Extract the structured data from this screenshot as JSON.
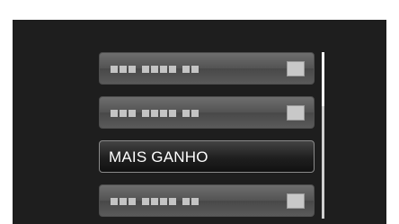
{
  "menu": {
    "items": [
      {
        "label": "",
        "state": "placeholder"
      },
      {
        "label": "",
        "state": "placeholder"
      },
      {
        "label": "MAIS GANHO",
        "state": "selected"
      },
      {
        "label": "",
        "state": "placeholder"
      }
    ]
  },
  "scrollbar": {
    "position": 0.0
  },
  "colors": {
    "screen_bg": "#1e1e1e",
    "item_bg": "#5a5a5a",
    "text": "#ffffff"
  }
}
